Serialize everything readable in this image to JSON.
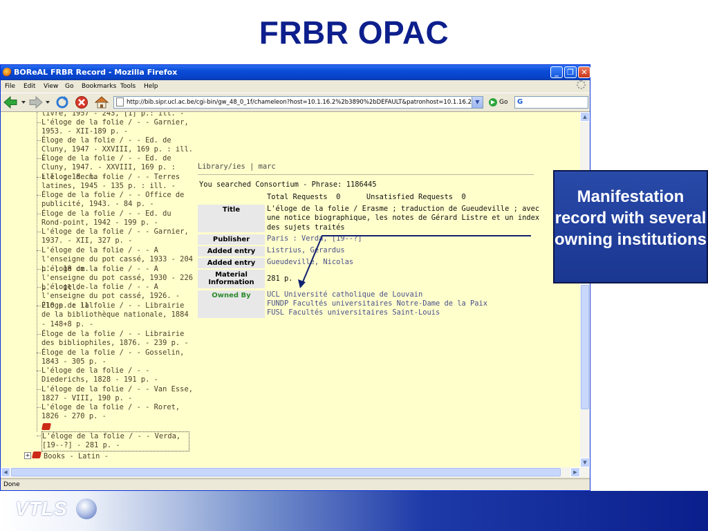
{
  "slide": {
    "title": "FRBR OPAC",
    "annotation": "Manifestation record with several owning institutions",
    "logo": "VTLS"
  },
  "browser": {
    "window_title": "BOReAL FRBR Record - Mozilla Firefox",
    "menu": [
      "File",
      "Edit",
      "View",
      "Go",
      "Bookmarks",
      "Tools",
      "Help"
    ],
    "url": "http://bib.sipr.ucl.ac.be/cgi-bin/gw_48_0_1f/chameleon?host=10.1.16.2%2b3890%2bDEFAULT&patronhost=10.1.16.2%2",
    "go_label": "Go",
    "search_engine_glyph": "G",
    "status": "Done"
  },
  "tree": {
    "items": [
      "livre, 1957 - 243, [1] p.: ill. -",
      "L'éloge de la folie / - - Garnier, 1953. - XII-189 p. -",
      "Éloge de la folie / - - Ed. de Cluny, 1947 - XXVIII, 169 p. : ill. -",
      "Éloge de la folie / - - Ed. de Cluny, 1947. - XXVIII, 169 p. : ill. ; 18 cm. -",
      "L'éloge de la folie / - - Terres latines, 1945 - 135 p. : ill. -",
      "Éloge de la folie / - - Office de publicité, 1943. - 84 p. -",
      "Éloge de la folie / - - Ed. du Rond-point, 1942 - 199 p. -",
      "L'éloge de la folie / - - Garnier, 1937. - XII, 327 p. -",
      "L'éloge de la folie / - - A l'enseigne du pot cassé, 1933 - 204 p. ; 18 cm. -",
      "L'éloge de la folie / - - A l'enseigne du pot cassé, 1930 - 226 p. : ill. -",
      "L'éloge de la folie / - - A l'enseigne du pot cassé, 1926. - 210 p. : ill. -",
      "Éloge de la folie / - - Librairie de la bibliothèque nationale, 1884 - 148+8 p. -",
      "Éloge de la folie / - - Librairie des bibliophiles, 1876. - 239 p. -",
      "Éloge de la folie / - - Gosselin, 1843 - 305 p. -",
      "L'éloge de la folie / - - Diederichs, 1828 - 191 p. -",
      "L'éloge de la folie / - - Van Esse, 1827 - VIII, 190 p. -",
      "L'éloge de la folie / - - Roret, 1826 - 270 p. -"
    ],
    "current": "L'éloge de la folie / - - Verda, [19--?] - 281 p. -",
    "next_group": "Books - Latin -"
  },
  "record": {
    "links": "Library/ies | marc",
    "search_line": "You searched Consortium - Phrase: 1186445",
    "counts": "Total Requests  0      Unsatisfied Requests  0",
    "fields": {
      "title_label": "Title",
      "title_value": "L'éloge de la folie / Erasme ; traduction de Gueudeville ; avec une notice biographique, les notes de Gérard Listre et un index des sujets traités",
      "publisher_label": "Publisher",
      "publisher_value": "Paris : Verda, [19--?]",
      "added1_label": "Added entry",
      "added1_value": "Listrius, Gerardus",
      "added2_label": "Added entry",
      "added2_value": "Gueudeville, Nicolas",
      "material_label": "Material Information",
      "material_value": "281 p.",
      "owned_label": "Owned By",
      "owners": [
        "UCL Université catholique de Louvain",
        "FUNDP Facultés universitaires Notre-Dame de la Paix",
        "FUSL Facultés universitaires Saint-Louis"
      ]
    }
  },
  "colors": {
    "slide_title": "#0d1f8c",
    "page_background": "#ffffcc",
    "owned_by_label": "#2c8a2c",
    "annotation_box": "#1a3691"
  }
}
